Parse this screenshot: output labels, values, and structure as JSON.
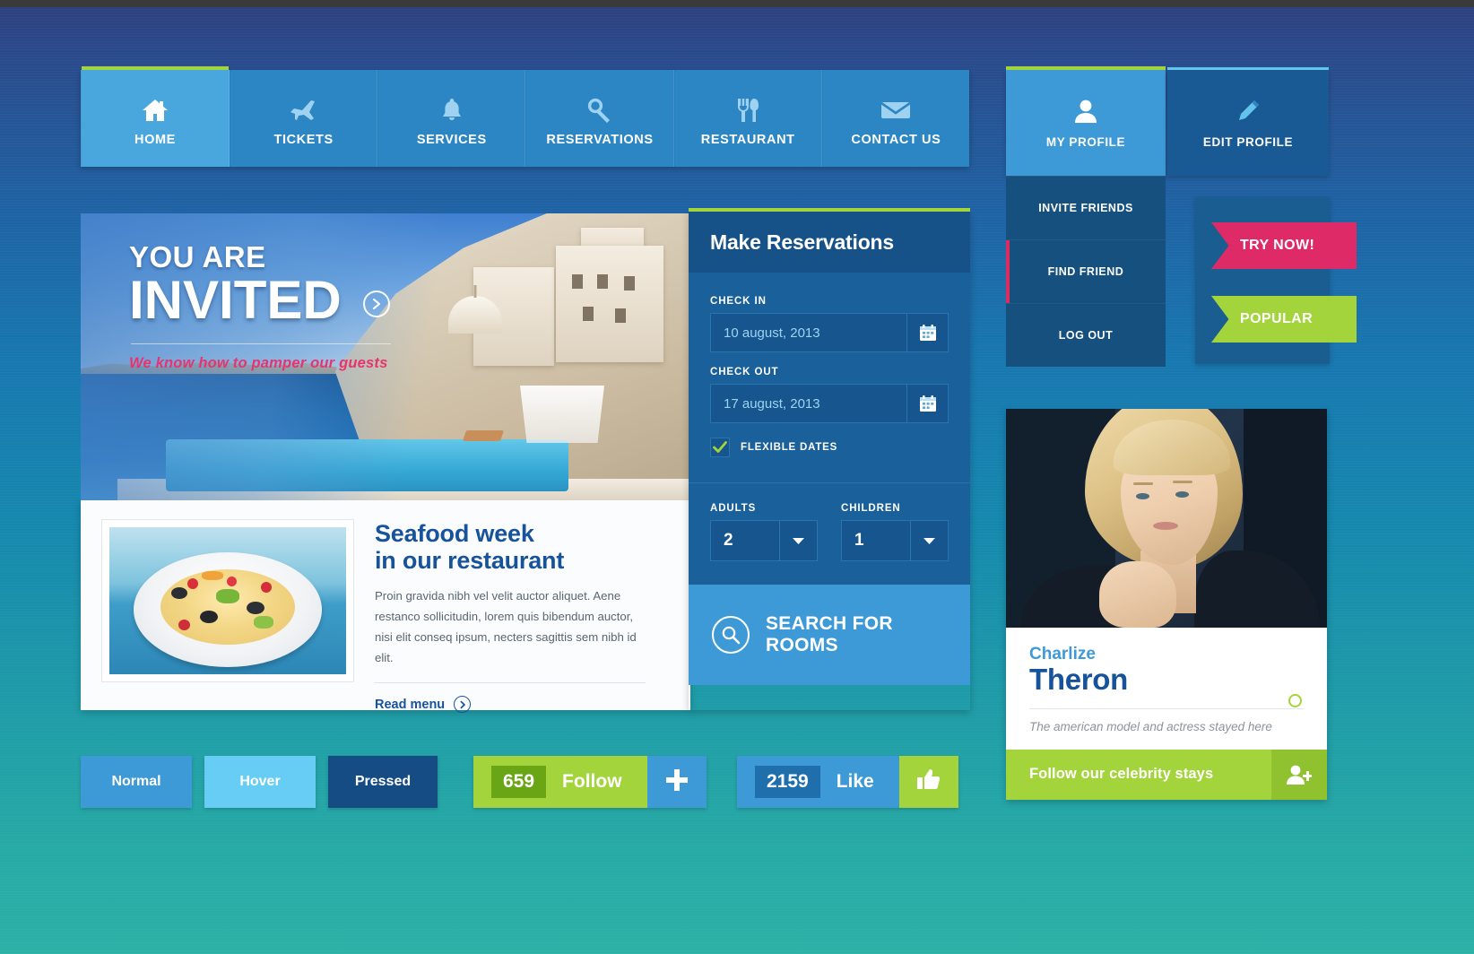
{
  "nav": {
    "items": [
      {
        "label": "HOME",
        "icon": "home-icon",
        "active": true
      },
      {
        "label": "TICKETS",
        "icon": "airplane-icon",
        "active": false
      },
      {
        "label": "SERVICES",
        "icon": "bell-icon",
        "active": false
      },
      {
        "label": "RESERVATIONS",
        "icon": "key-icon",
        "active": false
      },
      {
        "label": "RESTAURANT",
        "icon": "cutlery-icon",
        "active": false
      },
      {
        "label": "CONTACT US",
        "icon": "envelope-icon",
        "active": false
      }
    ]
  },
  "profile": {
    "my_profile_label": "MY PROFILE",
    "edit_profile_label": "EDIT PROFILE",
    "menu": [
      {
        "label": "INVITE FRIENDS",
        "marked": false
      },
      {
        "label": "FIND FRIEND",
        "marked": true
      },
      {
        "label": "LOG OUT",
        "marked": false
      }
    ]
  },
  "ribbons": [
    {
      "label": "TRY NOW!",
      "color": "#de2a67"
    },
    {
      "label": "POPULAR",
      "color": "#a3d43c"
    }
  ],
  "hero": {
    "kicker": "YOU ARE",
    "title": "INVITED",
    "subtitle": "We know how to pamper our guests"
  },
  "food": {
    "title_line1": "Seafood week",
    "title_line2": "in our restaurant",
    "body": "Proin gravida nibh vel velit auctor aliquet. Aene restanco sollicitudin, lorem quis bibendum auctor, nisi elit conseq ipsum, necters sagittis sem nibh id elit.",
    "link_label": "Read menu"
  },
  "reservations": {
    "title": "Make Reservations",
    "check_in_label": "CHECK IN",
    "check_in_value": "10 august, 2013",
    "check_out_label": "CHECK OUT",
    "check_out_value": "17 august, 2013",
    "flexible_label": "FLEXIBLE DATES",
    "flexible_checked": true,
    "adults_label": "ADULTS",
    "adults_value": "2",
    "children_label": "CHILDREN",
    "children_value": "1",
    "search_label": "SEARCH FOR ROOMS"
  },
  "celebrity": {
    "first_name": "Charlize",
    "last_name": "Theron",
    "note": "The american model and actress stayed here",
    "cta_label": "Follow our celebrity stays"
  },
  "buttons": {
    "states": [
      {
        "label": "Normal",
        "state": "normal"
      },
      {
        "label": "Hover",
        "state": "hover"
      },
      {
        "label": "Pressed",
        "state": "pressed"
      }
    ],
    "follow": {
      "count": "659",
      "label": "Follow",
      "icon": "plus-icon"
    },
    "like": {
      "count": "2159",
      "label": "Like",
      "icon": "thumbs-up-icon"
    }
  },
  "colors": {
    "accent_green": "#a3d43c",
    "accent_pink": "#de2a67",
    "accent_blue": "#3e9ad6",
    "deep_blue": "#17539b"
  }
}
